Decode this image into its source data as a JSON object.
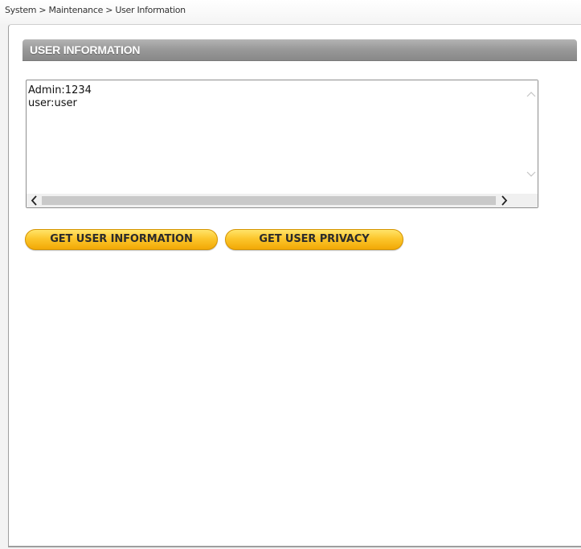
{
  "breadcrumb": "System > Maintenance > User Information",
  "section": {
    "title": "USER INFORMATION"
  },
  "textarea": {
    "content": "Admin:1234\nuser:user"
  },
  "buttons": {
    "get_user_information": "GET USER INFORMATION",
    "get_user_privacy": "GET USER PRIVACY"
  },
  "icons": {
    "scroll_up": "chevron-up-icon",
    "scroll_down": "chevron-down-icon",
    "scroll_left": "chevron-left-icon",
    "scroll_right": "chevron-right-icon"
  },
  "colors": {
    "header_gray": "#9a9a9a",
    "button_orange": "#fcc62c"
  }
}
